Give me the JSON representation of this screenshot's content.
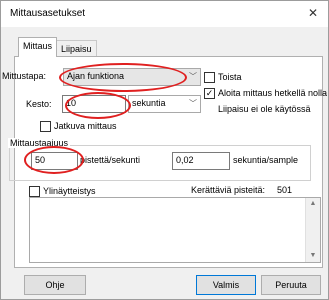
{
  "window": {
    "title": "Mittausasetukset",
    "close_icon": "close-icon"
  },
  "tabs": [
    {
      "label": "Mittaus"
    },
    {
      "label": "Liipaisu"
    }
  ],
  "measurement": {
    "mode_label": "Mittustapa:",
    "mode_value": "Ajan funktiona",
    "duration_label": "Kesto:",
    "duration_value": "10",
    "duration_unit": "sekuntia",
    "continuous_label": "Jatkuva mittaus",
    "repeat_label": "Toista",
    "start_label": "Aloita mittaus hetkellä nolla",
    "trigger_info": "Liipaisu ei ole käytössä"
  },
  "frequency": {
    "group_label": "Mittaustaajuus",
    "rate_value": "50",
    "rate_unit": "pistettä/sekunti",
    "interval_value": "0,02",
    "interval_unit": "sekuntia/sample"
  },
  "sampling": {
    "oversampling_label": "Ylinäytteistys",
    "collected_label": "Kerättäviä pisteitä:",
    "collected_value": "501"
  },
  "buttons": {
    "help": "Ohje",
    "ok": "Valmis",
    "cancel": "Peruuta"
  },
  "colors": {
    "highlight": "#e02020",
    "accent": "#0078d7"
  }
}
